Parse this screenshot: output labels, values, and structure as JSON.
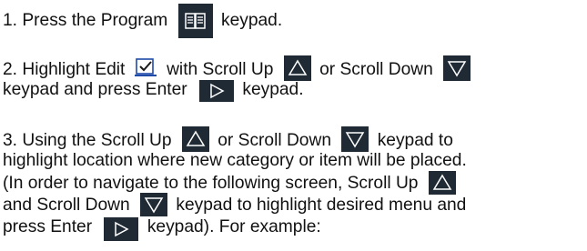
{
  "steps": [
    {
      "segments": {
        "a": "1. Press the Program",
        "b": "keypad."
      }
    },
    {
      "segments": {
        "a": "2. Highlight Edit",
        "b": "with Scroll Up",
        "c": "or Scroll Down",
        "d": "keypad and press Enter",
        "e": "keypad."
      }
    },
    {
      "segments": {
        "a": "3. Using the Scroll Up",
        "b": "or Scroll Down",
        "c": "keypad to",
        "d": "highlight location where new category or item will be placed.",
        "e": "(In order to navigate to the following screen, Scroll Up",
        "f": "and Scroll Down",
        "g": "keypad to highlight desired menu and",
        "h": "press Enter",
        "i": "keypad). For example:"
      }
    }
  ],
  "icons": {
    "program_key": "program-book-icon",
    "edit_icon": "edit-check-icon",
    "scroll_up_key": "scroll-up-triangle-icon",
    "scroll_down_key": "scroll-down-triangle-icon",
    "enter_key": "enter-play-icon"
  },
  "colors": {
    "key_background": "#1f2a35",
    "key_glyph": "#ffffff",
    "edit_icon_stroke": "#1f4aa8"
  }
}
